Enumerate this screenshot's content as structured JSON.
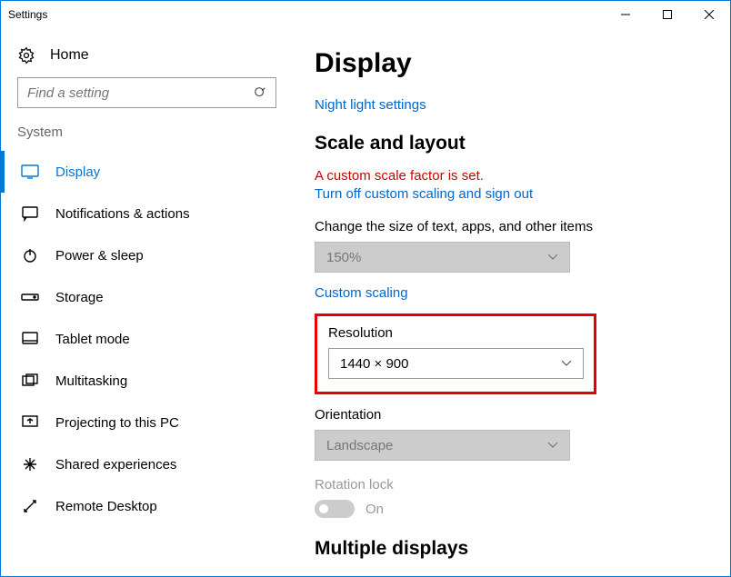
{
  "window": {
    "title": "Settings"
  },
  "sidebar": {
    "home": "Home",
    "search_placeholder": "Find a setting",
    "category": "System",
    "items": [
      {
        "label": "Display"
      },
      {
        "label": "Notifications & actions"
      },
      {
        "label": "Power & sleep"
      },
      {
        "label": "Storage"
      },
      {
        "label": "Tablet mode"
      },
      {
        "label": "Multitasking"
      },
      {
        "label": "Projecting to this PC"
      },
      {
        "label": "Shared experiences"
      },
      {
        "label": "Remote Desktop"
      }
    ]
  },
  "main": {
    "title": "Display",
    "night_light_link": "Night light settings",
    "scale_section": "Scale and layout",
    "warning": "A custom scale factor is set.",
    "turn_off_link": "Turn off custom scaling and sign out",
    "scale_label": "Change the size of text, apps, and other items",
    "scale_value": "150%",
    "custom_scaling_link": "Custom scaling",
    "resolution_label": "Resolution",
    "resolution_value": "1440 × 900",
    "orientation_label": "Orientation",
    "orientation_value": "Landscape",
    "rotation_lock_label": "Rotation lock",
    "rotation_lock_value": "On",
    "multiple_displays": "Multiple displays"
  }
}
